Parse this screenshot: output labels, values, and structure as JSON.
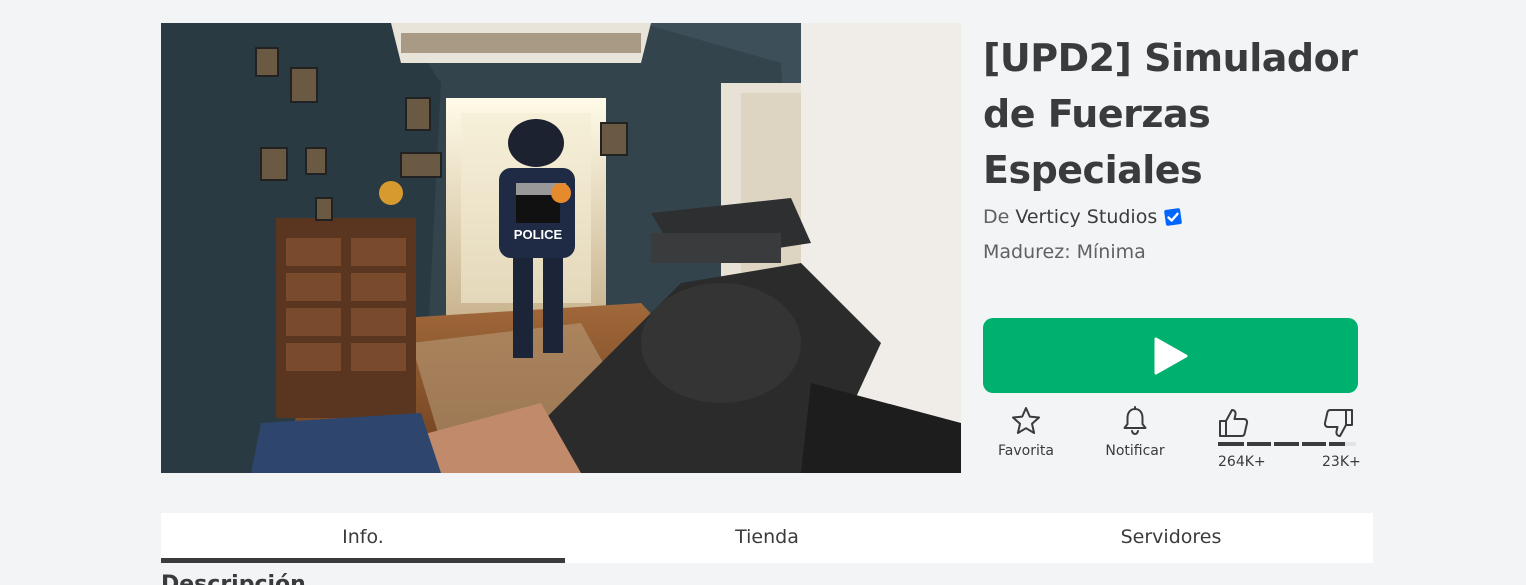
{
  "game": {
    "title": "[UPD2] Simulador de Fuerzas Especiales",
    "by_label": "De",
    "creator": "Verticy Studios",
    "maturity": "Madurez: Mínima",
    "thumbnail_text": "POLICE"
  },
  "play_button": {
    "icon": "play-icon"
  },
  "actions": {
    "favorite_label": "Favorita",
    "notify_label": "Notificar"
  },
  "votes": {
    "up_count": "264K+",
    "down_count": "23K+",
    "up_ratio": 0.92
  },
  "tabs": [
    {
      "label": "Info.",
      "active": true
    },
    {
      "label": "Tienda",
      "active": false
    },
    {
      "label": "Servidores",
      "active": false
    }
  ],
  "section": {
    "heading": "Descripción"
  },
  "colors": {
    "play": "#00b06f",
    "verified": "#0066ff",
    "text": "#393b3d",
    "background": "#f2f4f5"
  }
}
